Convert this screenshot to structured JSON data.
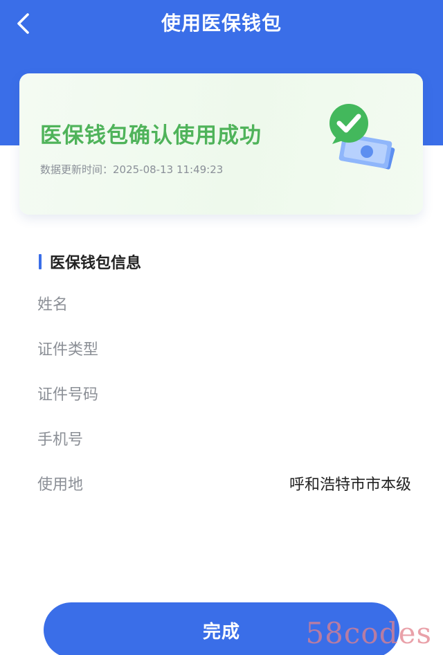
{
  "nav": {
    "title": "使用医保钱包",
    "back_icon": "chevron-left-icon"
  },
  "card": {
    "title": "医保钱包确认使用成功",
    "update_time": "数据更新时间：2025-08-13 11:49:23",
    "illustration_icon": "check-badge-money-icon"
  },
  "section": {
    "title": "医保钱包信息"
  },
  "info": [
    {
      "label": "姓名",
      "value": ""
    },
    {
      "label": "证件类型",
      "value": ""
    },
    {
      "label": "证件号码",
      "value": ""
    },
    {
      "label": "手机号",
      "value": ""
    },
    {
      "label": "使用地",
      "value": "呼和浩特市市本级"
    }
  ],
  "footer": {
    "done_label": "完成"
  },
  "watermark": "58codes",
  "colors": {
    "primary": "#3a6ee8",
    "success": "#4fb35a",
    "label": "#8b8f96",
    "text": "#222222"
  }
}
